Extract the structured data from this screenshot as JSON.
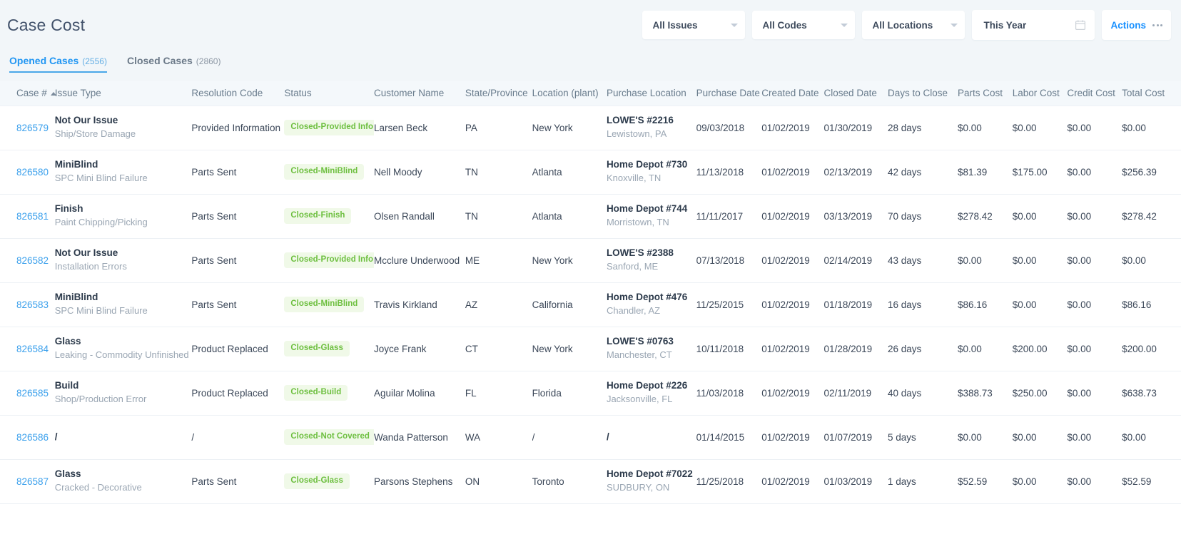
{
  "header": {
    "title": "Case Cost",
    "filters": [
      {
        "name": "issues",
        "value": "All Issues"
      },
      {
        "name": "codes",
        "value": "All Codes"
      },
      {
        "name": "locations",
        "value": "All Locations"
      }
    ],
    "date_range": {
      "value": "This Year",
      "icon": "calendar-icon"
    },
    "actions": {
      "label": "Actions",
      "icon": "ellipsis-icon"
    }
  },
  "tabs": [
    {
      "label": "Opened Cases",
      "count": "(2556)",
      "active": true
    },
    {
      "label": "Closed Cases",
      "count": "(2860)",
      "active": false
    }
  ],
  "table": {
    "sort": {
      "column": "Case #",
      "direction": "asc"
    },
    "columns": [
      "Case #",
      "Issue Type",
      "Resolution Code",
      "Status",
      "Customer Name",
      "State/Province",
      "Location (plant)",
      "Purchase Location",
      "Purchase Date",
      "Created Date",
      "Closed Date",
      "Days to Close",
      "Parts Cost",
      "Labor Cost",
      "Credit Cost",
      "Total Cost"
    ],
    "rows": [
      {
        "case": "826579",
        "issue_main": "Not Our Issue",
        "issue_sub": "Ship/Store Damage",
        "resolution": "Provided Information",
        "status": "Closed-Provided Info",
        "customer": "Larsen Beck",
        "state": "PA",
        "location": "New York",
        "purchase_main": "LOWE'S #2216",
        "purchase_sub": "Lewistown, PA",
        "purchase_date": "09/03/2018",
        "created_date": "01/02/2019",
        "closed_date": "01/30/2019",
        "days_to_close": "28 days",
        "parts_cost": "$0.00",
        "labor_cost": "$0.00",
        "credit_cost": "$0.00",
        "total_cost": "$0.00"
      },
      {
        "case": "826580",
        "issue_main": "MiniBlind",
        "issue_sub": "SPC Mini Blind Failure",
        "resolution": "Parts Sent",
        "status": "Closed-MiniBlind",
        "customer": "Nell Moody",
        "state": "TN",
        "location": "Atlanta",
        "purchase_main": "Home Depot #730",
        "purchase_sub": "Knoxville, TN",
        "purchase_date": "11/13/2018",
        "created_date": "01/02/2019",
        "closed_date": "02/13/2019",
        "days_to_close": "42 days",
        "parts_cost": "$81.39",
        "labor_cost": "$175.00",
        "credit_cost": "$0.00",
        "total_cost": "$256.39"
      },
      {
        "case": "826581",
        "issue_main": "Finish",
        "issue_sub": "Paint Chipping/Picking",
        "resolution": "Parts Sent",
        "status": "Closed-Finish",
        "customer": "Olsen Randall",
        "state": "TN",
        "location": "Atlanta",
        "purchase_main": "Home Depot #744",
        "purchase_sub": "Morristown, TN",
        "purchase_date": "11/11/2017",
        "created_date": "01/02/2019",
        "closed_date": "03/13/2019",
        "days_to_close": "70 days",
        "parts_cost": "$278.42",
        "labor_cost": "$0.00",
        "credit_cost": "$0.00",
        "total_cost": "$278.42"
      },
      {
        "case": "826582",
        "issue_main": "Not Our Issue",
        "issue_sub": "Installation Errors",
        "resolution": "Parts Sent",
        "status": "Closed-Provided Info",
        "customer": "Mcclure Underwood",
        "state": "ME",
        "location": "New York",
        "purchase_main": "LOWE'S #2388",
        "purchase_sub": "Sanford, ME",
        "purchase_date": "07/13/2018",
        "created_date": "01/02/2019",
        "closed_date": "02/14/2019",
        "days_to_close": "43 days",
        "parts_cost": "$0.00",
        "labor_cost": "$0.00",
        "credit_cost": "$0.00",
        "total_cost": "$0.00"
      },
      {
        "case": "826583",
        "issue_main": "MiniBlind",
        "issue_sub": "SPC Mini Blind Failure",
        "resolution": "Parts Sent",
        "status": "Closed-MiniBlind",
        "customer": "Travis Kirkland",
        "state": "AZ",
        "location": "California",
        "purchase_main": "Home Depot #476",
        "purchase_sub": "Chandler, AZ",
        "purchase_date": "11/25/2015",
        "created_date": "01/02/2019",
        "closed_date": "01/18/2019",
        "days_to_close": "16 days",
        "parts_cost": "$86.16",
        "labor_cost": "$0.00",
        "credit_cost": "$0.00",
        "total_cost": "$86.16"
      },
      {
        "case": "826584",
        "issue_main": "Glass",
        "issue_sub": "Leaking - Commodity Unfinished",
        "resolution": "Product Replaced",
        "status": "Closed-Glass",
        "customer": "Joyce Frank",
        "state": "CT",
        "location": "New York",
        "purchase_main": "LOWE'S #0763",
        "purchase_sub": "Manchester, CT",
        "purchase_date": "10/11/2018",
        "created_date": "01/02/2019",
        "closed_date": "01/28/2019",
        "days_to_close": "26 days",
        "parts_cost": "$0.00",
        "labor_cost": "$200.00",
        "credit_cost": "$0.00",
        "total_cost": "$200.00"
      },
      {
        "case": "826585",
        "issue_main": "Build",
        "issue_sub": "Shop/Production Error",
        "resolution": "Product Replaced",
        "status": "Closed-Build",
        "customer": "Aguilar Molina",
        "state": "FL",
        "location": "Florida",
        "purchase_main": "Home Depot #226",
        "purchase_sub": "Jacksonville, FL",
        "purchase_date": "11/03/2018",
        "created_date": "01/02/2019",
        "closed_date": "02/11/2019",
        "days_to_close": "40 days",
        "parts_cost": "$388.73",
        "labor_cost": "$250.00",
        "credit_cost": "$0.00",
        "total_cost": "$638.73"
      },
      {
        "case": "826586",
        "issue_main": "/",
        "issue_sub": "",
        "resolution": "/",
        "status": "Closed-Not Covered",
        "customer": "Wanda Patterson",
        "state": "WA",
        "location": "/",
        "purchase_main": "/",
        "purchase_sub": "",
        "purchase_date": "01/14/2015",
        "created_date": "01/02/2019",
        "closed_date": "01/07/2019",
        "days_to_close": "5 days",
        "parts_cost": "$0.00",
        "labor_cost": "$0.00",
        "credit_cost": "$0.00",
        "total_cost": "$0.00"
      },
      {
        "case": "826587",
        "issue_main": "Glass",
        "issue_sub": "Cracked - Decorative",
        "resolution": "Parts Sent",
        "status": "Closed-Glass",
        "customer": "Parsons Stephens",
        "state": "ON",
        "location": "Toronto",
        "purchase_main": "Home Depot #7022",
        "purchase_sub": "SUDBURY, ON",
        "purchase_date": "11/25/2018",
        "created_date": "01/02/2019",
        "closed_date": "01/03/2019",
        "days_to_close": "1 days",
        "parts_cost": "$52.59",
        "labor_cost": "$0.00",
        "credit_cost": "$0.00",
        "total_cost": "$52.59"
      }
    ]
  },
  "colors": {
    "accent": "#2196f3",
    "link": "#3ba0ec",
    "badge_text": "#6dbf3f",
    "badge_bg": "#f0f9e8",
    "page_bg": "#f2f6f9",
    "header_row_bg": "#f4f8fb"
  }
}
